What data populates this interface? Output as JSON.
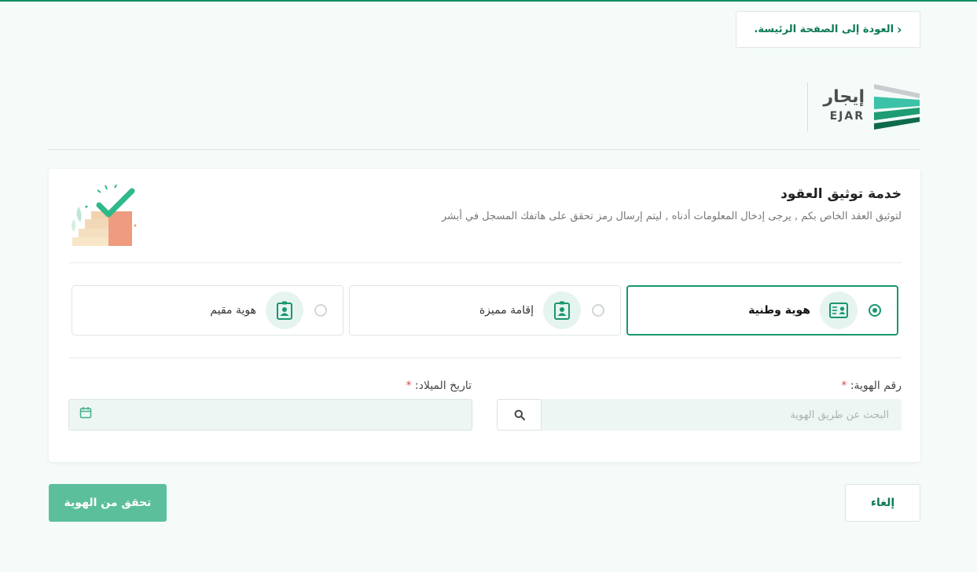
{
  "header": {
    "back_label": "العودة إلى الصفحة الرئيسة.",
    "logo_ar": "إيجار",
    "logo_en": "EJAR"
  },
  "card": {
    "title": "خدمة توثيق العقود",
    "subtitle": "لتوثيق العقد الخاص بكم , يرجى إدخال المعلومات أدناه , ليتم إرسال رمز تحقق على هاتفك المسجل في أبشر"
  },
  "id_types": [
    {
      "label": "هوية وطنية",
      "selected": true,
      "icon": "national-id-card-icon"
    },
    {
      "label": "إقامة مميزة",
      "selected": false,
      "icon": "badge-id-icon"
    },
    {
      "label": "هوية مقيم",
      "selected": false,
      "icon": "badge-id-icon"
    }
  ],
  "form": {
    "id_label": "رقم الهوية:",
    "id_placeholder": "البحث عن طريق الهوية",
    "dob_label": "تاريخ الميلاد:",
    "required_mark": "*"
  },
  "actions": {
    "cancel_label": "إلغاء",
    "verify_label": "تحقق من الهوية"
  },
  "colors": {
    "accent": "#1a9670",
    "primary_button": "#5bbf9b",
    "required": "#e0484c"
  }
}
